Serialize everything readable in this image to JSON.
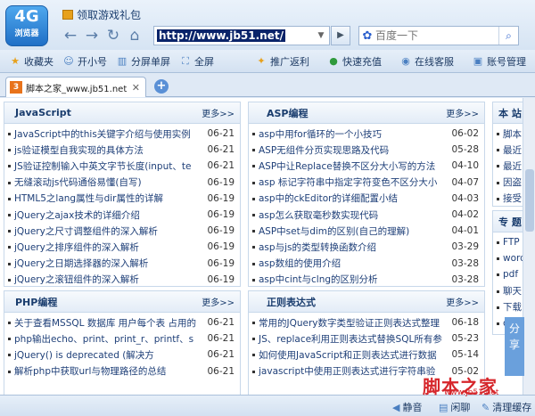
{
  "app": {
    "logo_top": "4G",
    "logo_bottom": "浏览器",
    "gift_label": "领取游戏礼包"
  },
  "address": {
    "url": "http://www.jb51.net/"
  },
  "search": {
    "placeholder": "百度一下"
  },
  "toolbar": {
    "left": [
      "收藏夹",
      "开小号",
      "分屏单屏",
      "全屏"
    ],
    "right": [
      "推广返利",
      "快速充值",
      "在线客服",
      "账号管理"
    ]
  },
  "tab": {
    "title": "脚本之家_www.jb51.net"
  },
  "panels": {
    "js": {
      "title": "JavaScript",
      "more": "更多>>",
      "items": [
        {
          "t": "JavaScript中的this关键字介绍与使用实例",
          "d": "06-21"
        },
        {
          "t": "js验证模型自我实现的具体方法",
          "d": "06-21"
        },
        {
          "t": "JS验证控制输入中英文字节长度(input、te",
          "d": "06-21"
        },
        {
          "t": "无缝滚动js代码通俗易懂(自写)",
          "d": "06-19"
        },
        {
          "t": "HTML5之lang属性与dir属性的详解",
          "d": "06-19"
        },
        {
          "t": "jQuery之ajax技术的详细介绍",
          "d": "06-19"
        },
        {
          "t": "jQuery之尺寸调整组件的深入解析",
          "d": "06-19"
        },
        {
          "t": "jQuery之排序组件的深入解析",
          "d": "06-19"
        },
        {
          "t": "jQuery之日期选择器的深入解析",
          "d": "06-19"
        },
        {
          "t": "jQuery之滚钮组件的深入解析",
          "d": "06-19"
        }
      ]
    },
    "asp": {
      "title": "ASP编程",
      "more": "更多>>",
      "items": [
        {
          "t": "asp中用for循环的一个小技巧",
          "d": "06-02"
        },
        {
          "t": "ASP无组件分页实现思路及代码",
          "d": "05-28"
        },
        {
          "t": "ASP中让Replace替换不区分大小写的方法",
          "d": "04-10"
        },
        {
          "t": "asp 标记字符串中指定字符变色不区分大小",
          "d": "04-07"
        },
        {
          "t": "asp中的ckEditor的详细配置小结",
          "d": "04-03"
        },
        {
          "t": "asp怎么获取毫秒数实现代码",
          "d": "04-02"
        },
        {
          "t": "ASP中set与dim的区别(自己的理解)",
          "d": "04-01"
        },
        {
          "t": "asp与js的类型转换函数介绍",
          "d": "03-29"
        },
        {
          "t": "asp数组的使用介绍",
          "d": "03-28"
        },
        {
          "t": "asp中cint与clng的区别分析",
          "d": "03-28"
        }
      ]
    },
    "php": {
      "title": "PHP编程",
      "more": "更多>>",
      "items": [
        {
          "t": "关于查看MSSQL 数据库 用户每个表 占用的",
          "d": "06-21"
        },
        {
          "t": "php输出echo、print、print_r、printf、s",
          "d": "06-21"
        },
        {
          "t": "jQuery() is deprecated (解决方",
          "d": "06-21"
        },
        {
          "t": "解析php中获取url与物理路径的总结",
          "d": "06-21"
        }
      ]
    },
    "regex": {
      "title": "正则表达式",
      "more": "更多>>",
      "items": [
        {
          "t": "常用的JQuery数字类型验证正则表达式整理",
          "d": "06-18"
        },
        {
          "t": "JS、replace利用正则表达式替换SQL所有参",
          "d": "05-23"
        },
        {
          "t": "如何使用JavaScript和正则表达式进行数据",
          "d": "05-14"
        },
        {
          "t": "javascript中使用正则表达式进行字符串验",
          "d": "05-02"
        }
      ]
    },
    "side1": {
      "title": "本 站",
      "items": [
        "脚本",
        "最近",
        "最近",
        "因盗",
        "接受"
      ]
    },
    "side2": {
      "title": "专 题",
      "items": [
        "FTP",
        "word",
        "pdf",
        "聊天",
        "下载",
        "qq"
      ]
    }
  },
  "share_label": "分享",
  "status": {
    "mute": "静音",
    "transfer": "闲聊",
    "clear": "清理缓存"
  },
  "watermark": {
    "main": "脚本之家",
    "sub": "www.jb51.net"
  }
}
